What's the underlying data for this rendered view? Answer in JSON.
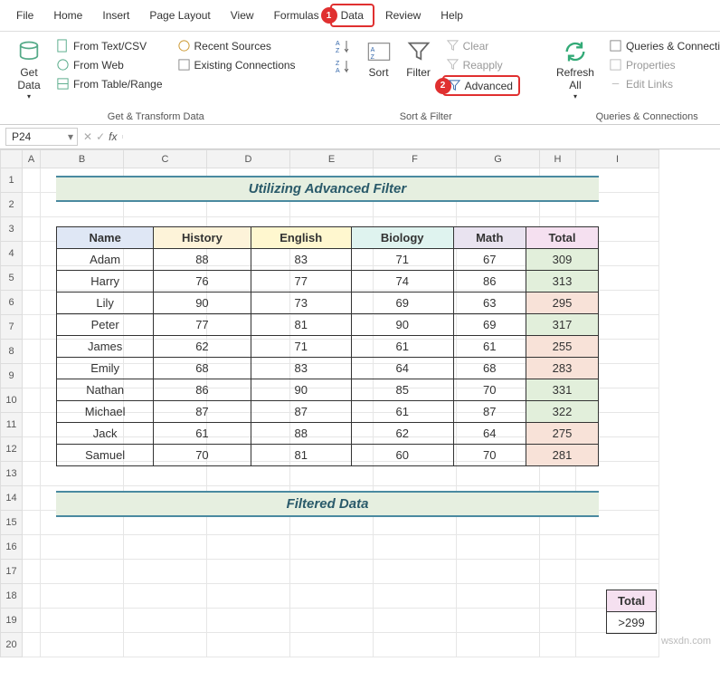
{
  "menu": {
    "items": [
      "File",
      "Home",
      "Insert",
      "Page Layout",
      "View",
      "Formulas",
      "Data",
      "Review",
      "Help"
    ],
    "active_index": 6,
    "badge": "1"
  },
  "ribbon": {
    "group1": {
      "label": "Get & Transform Data",
      "getdata": "Get\nData",
      "items": [
        "From Text/CSV",
        "From Web",
        "From Table/Range",
        "Recent Sources",
        "Existing Connections"
      ]
    },
    "group2": {
      "label": "Sort & Filter",
      "sort": "Sort",
      "filter": "Filter",
      "clear": "Clear",
      "reapply": "Reapply",
      "advanced": "Advanced",
      "badge": "2"
    },
    "group3": {
      "label": "Queries & Connections",
      "refresh": "Refresh\nAll",
      "items": [
        "Queries & Connections",
        "Properties",
        "Edit Links"
      ]
    }
  },
  "formula": {
    "namebox": "P24",
    "fx": ""
  },
  "sheet": {
    "columns": [
      "A",
      "B",
      "C",
      "D",
      "E",
      "F",
      "G",
      "H",
      "I"
    ],
    "rows": [
      1,
      2,
      3,
      4,
      5,
      6,
      7,
      8,
      9,
      10,
      11,
      12,
      13,
      14,
      15,
      16,
      17,
      18,
      19,
      20
    ],
    "title": "Utilizing Advanced Filter",
    "subtitle": "Filtered Data",
    "headers": [
      "Name",
      "History",
      "English",
      "Biology",
      "Math",
      "Total"
    ],
    "data": [
      {
        "name": "Adam",
        "h": 88,
        "e": 83,
        "b": 71,
        "m": 67,
        "t": 309,
        "cls": "tgood"
      },
      {
        "name": "Harry",
        "h": 76,
        "e": 77,
        "b": 74,
        "m": 86,
        "t": 313,
        "cls": "tgood"
      },
      {
        "name": "Lily",
        "h": 90,
        "e": 73,
        "b": 69,
        "m": 63,
        "t": 295,
        "cls": "tbad"
      },
      {
        "name": "Peter",
        "h": 77,
        "e": 81,
        "b": 90,
        "m": 69,
        "t": 317,
        "cls": "tgood"
      },
      {
        "name": "James",
        "h": 62,
        "e": 71,
        "b": 61,
        "m": 61,
        "t": 255,
        "cls": "tbad"
      },
      {
        "name": "Emily",
        "h": 68,
        "e": 83,
        "b": 64,
        "m": 68,
        "t": 283,
        "cls": "tbad"
      },
      {
        "name": "Nathan",
        "h": 86,
        "e": 90,
        "b": 85,
        "m": 70,
        "t": 331,
        "cls": "tgood"
      },
      {
        "name": "Michael",
        "h": 87,
        "e": 87,
        "b": 61,
        "m": 87,
        "t": 322,
        "cls": "tgood"
      },
      {
        "name": "Jack",
        "h": 61,
        "e": 88,
        "b": 62,
        "m": 64,
        "t": 275,
        "cls": "tbad"
      },
      {
        "name": "Samuel",
        "h": 70,
        "e": 81,
        "b": 60,
        "m": 70,
        "t": 281,
        "cls": "tbad"
      }
    ],
    "criteria": {
      "header": "Total",
      "value": ">299"
    }
  },
  "watermark": "wsxdn.com"
}
